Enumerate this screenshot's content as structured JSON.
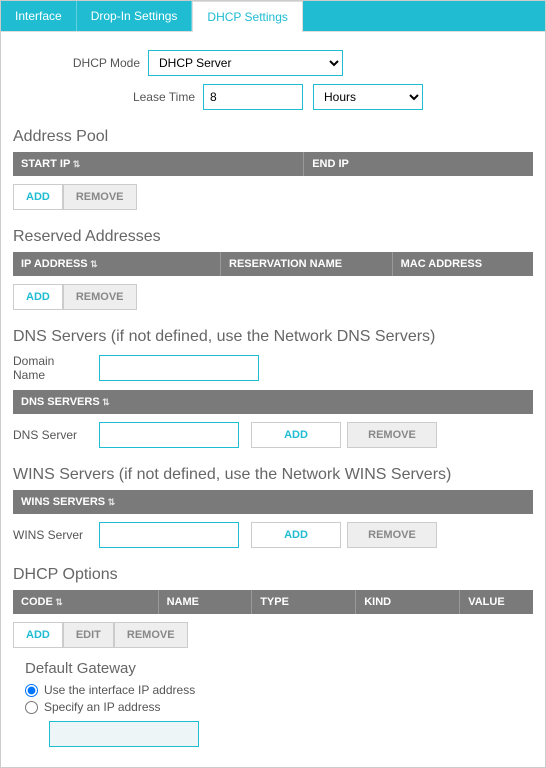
{
  "tabs": {
    "interface": "Interface",
    "dropin": "Drop-In Settings",
    "dhcp": "DHCP Settings"
  },
  "dhcpMode": {
    "label": "DHCP Mode",
    "value": "DHCP Server"
  },
  "leaseTime": {
    "label": "Lease Time",
    "value": "8",
    "unit": "Hours"
  },
  "addressPool": {
    "title": "Address Pool",
    "cols": {
      "start": "START IP",
      "end": "END IP"
    },
    "buttons": {
      "add": "ADD",
      "remove": "REMOVE"
    }
  },
  "reserved": {
    "title": "Reserved Addresses",
    "cols": {
      "ip": "IP ADDRESS",
      "name": "RESERVATION NAME",
      "mac": "MAC ADDRESS"
    },
    "buttons": {
      "add": "ADD",
      "remove": "REMOVE"
    }
  },
  "dns": {
    "title": "DNS Servers (if not defined, use the Network DNS Servers)",
    "domainLabel": "Domain Name",
    "domainValue": "",
    "header": "DNS SERVERS",
    "serverLabel": "DNS Server",
    "serverValue": "",
    "buttons": {
      "add": "ADD",
      "remove": "REMOVE"
    }
  },
  "wins": {
    "title": "WINS Servers (if not defined, use the Network WINS Servers)",
    "header": "WINS SERVERS",
    "serverLabel": "WINS Server",
    "serverValue": "",
    "buttons": {
      "add": "ADD",
      "remove": "REMOVE"
    }
  },
  "options": {
    "title": "DHCP Options",
    "cols": {
      "code": "CODE",
      "name": "NAME",
      "type": "TYPE",
      "kind": "KIND",
      "value": "VALUE"
    },
    "buttons": {
      "add": "ADD",
      "edit": "EDIT",
      "remove": "REMOVE"
    }
  },
  "gateway": {
    "title": "Default Gateway",
    "useInterface": "Use the interface IP address",
    "specify": "Specify an IP address",
    "ipValue": ""
  }
}
